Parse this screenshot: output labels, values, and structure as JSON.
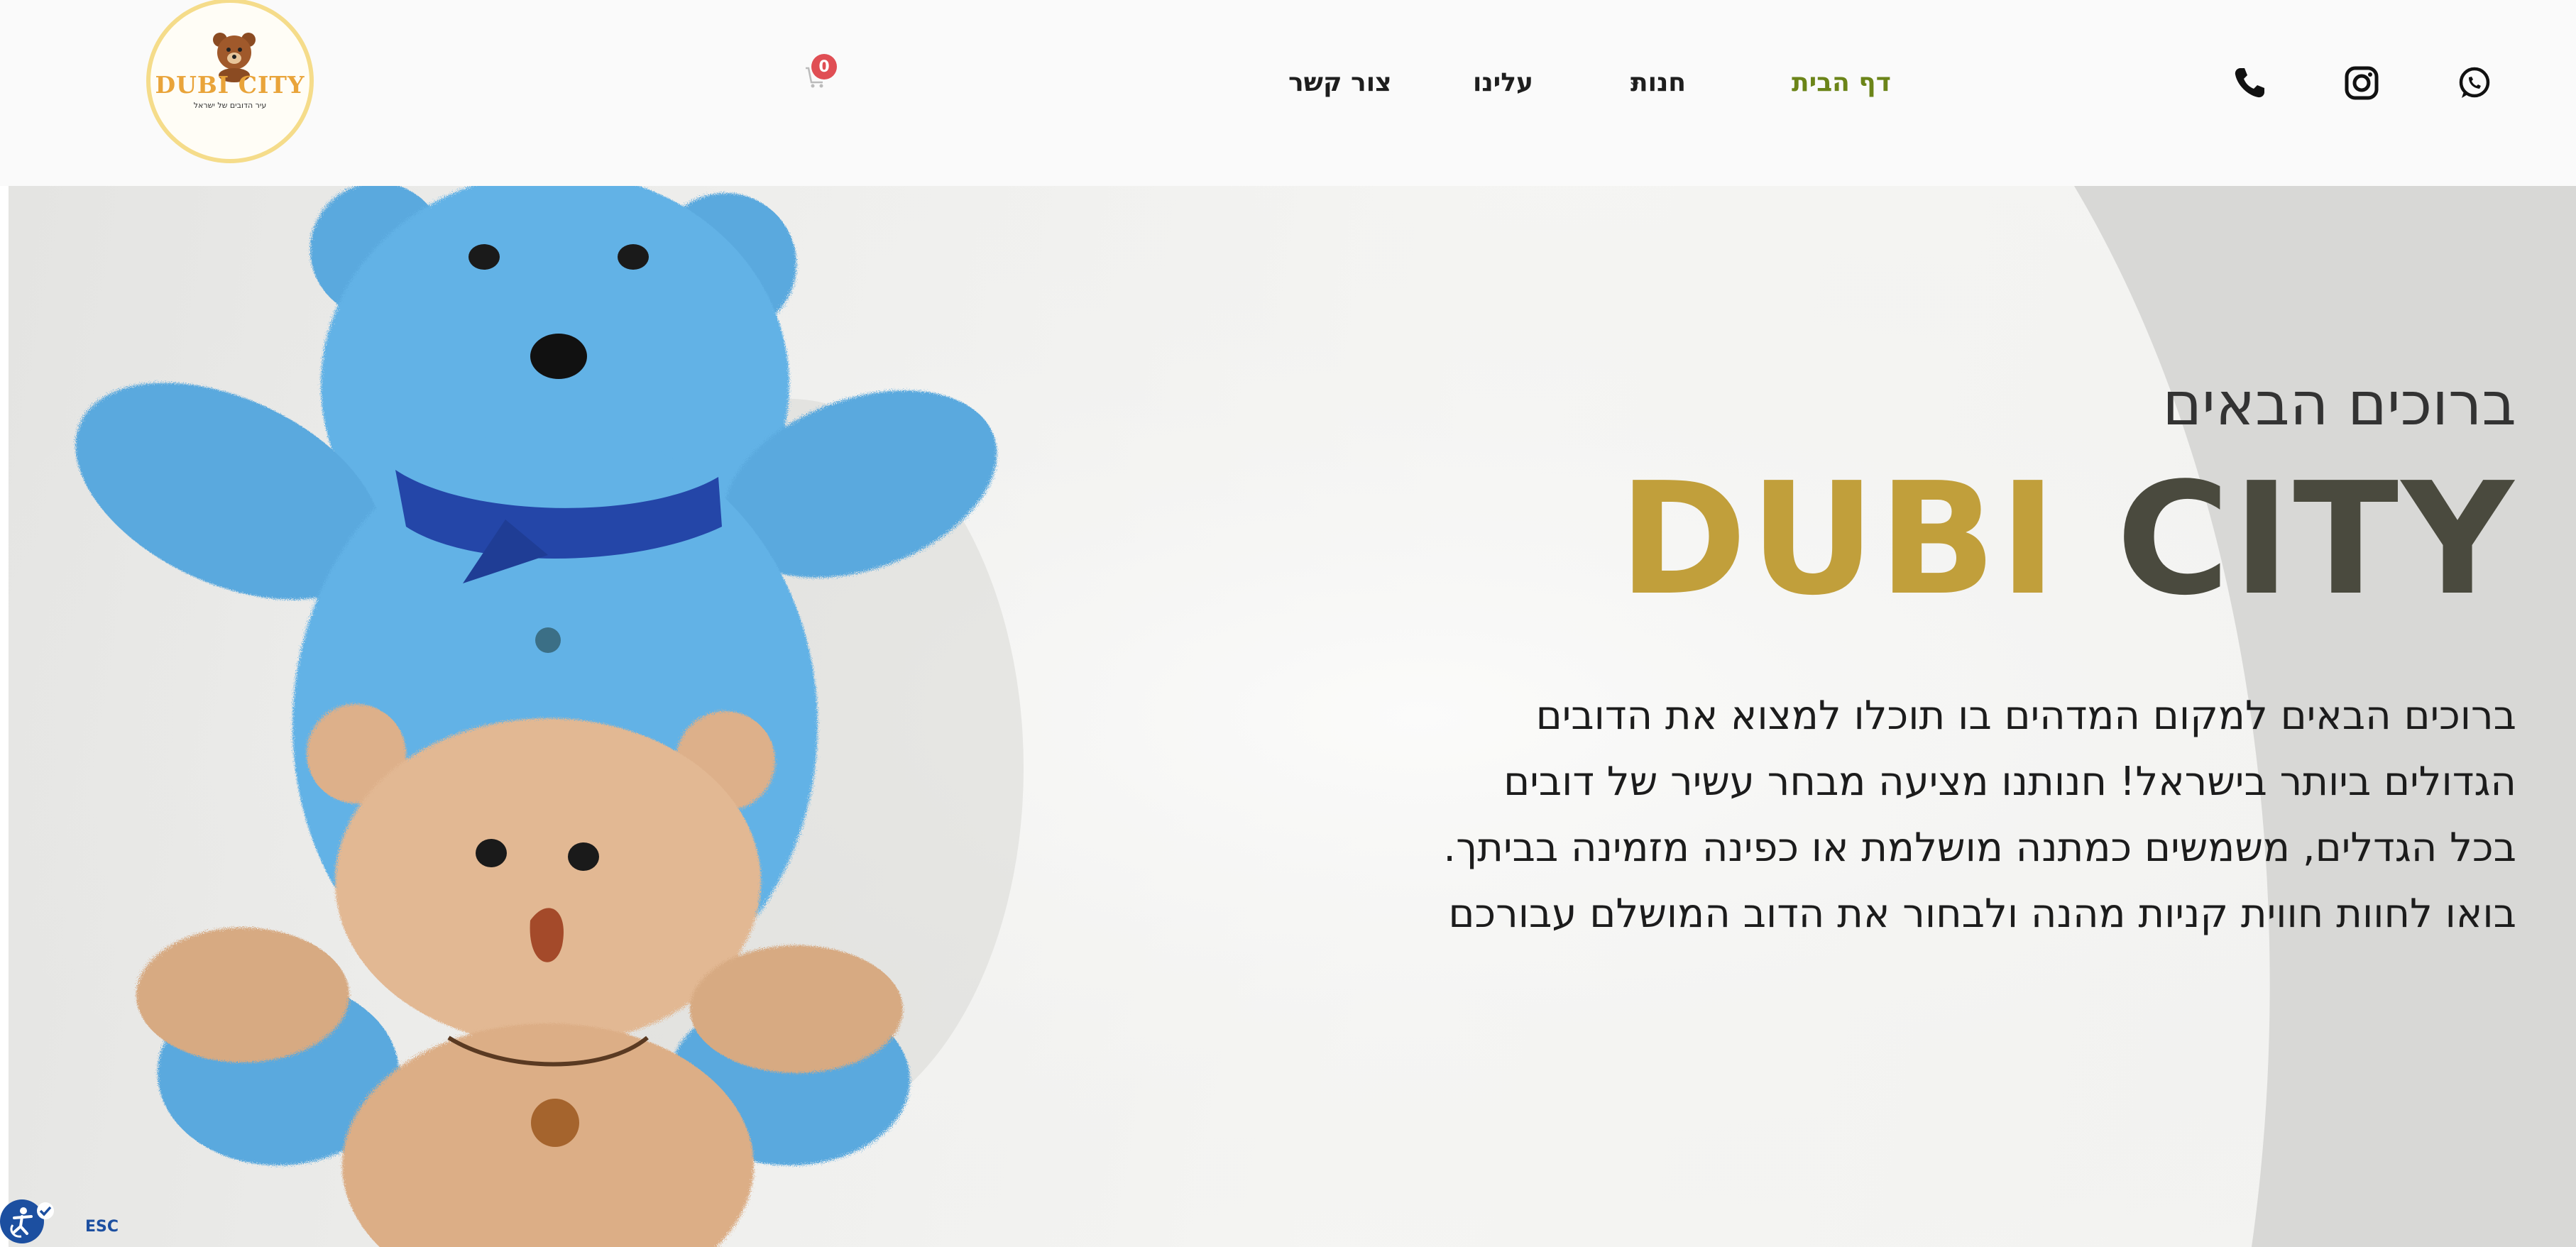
{
  "header": {
    "logo": {
      "title": "DUBI CITY",
      "tagline": "עיר הדובים של ישראל"
    },
    "cart": {
      "count": "0"
    },
    "nav": {
      "contact": "צור קשר",
      "about": "עלינו",
      "shop": "חנות",
      "home": "דף הבית"
    },
    "social": [
      "phone-icon",
      "instagram-icon",
      "whatsapp-icon"
    ]
  },
  "hero": {
    "welcome": "ברוכים הבאים",
    "brand_part1": "DUBI",
    "brand_part2": "CITY",
    "text_lines": [
      "ברוכים הבאים למקום המדהים בו תוכלו למצוא את הדובים",
      "הגדולים ביותר בישראל! חנותנו מציעה מבחר עשיר של דובים",
      "בכל הגדלים, משמשים כמתנה מושלמת או כפינה מזמינה בביתך.",
      "בואו לחוות חווית קניות מהנה ולבחור את הדוב המושלם עבורכם"
    ]
  },
  "accessibility": {
    "esc_label": "ESC"
  },
  "colors": {
    "accent_gold": "#c19f3b",
    "dark_olive": "#4a4a3e",
    "nav_active": "#6b8418",
    "badge_red": "#e04e54",
    "a11y_blue": "#1c4fa0"
  }
}
